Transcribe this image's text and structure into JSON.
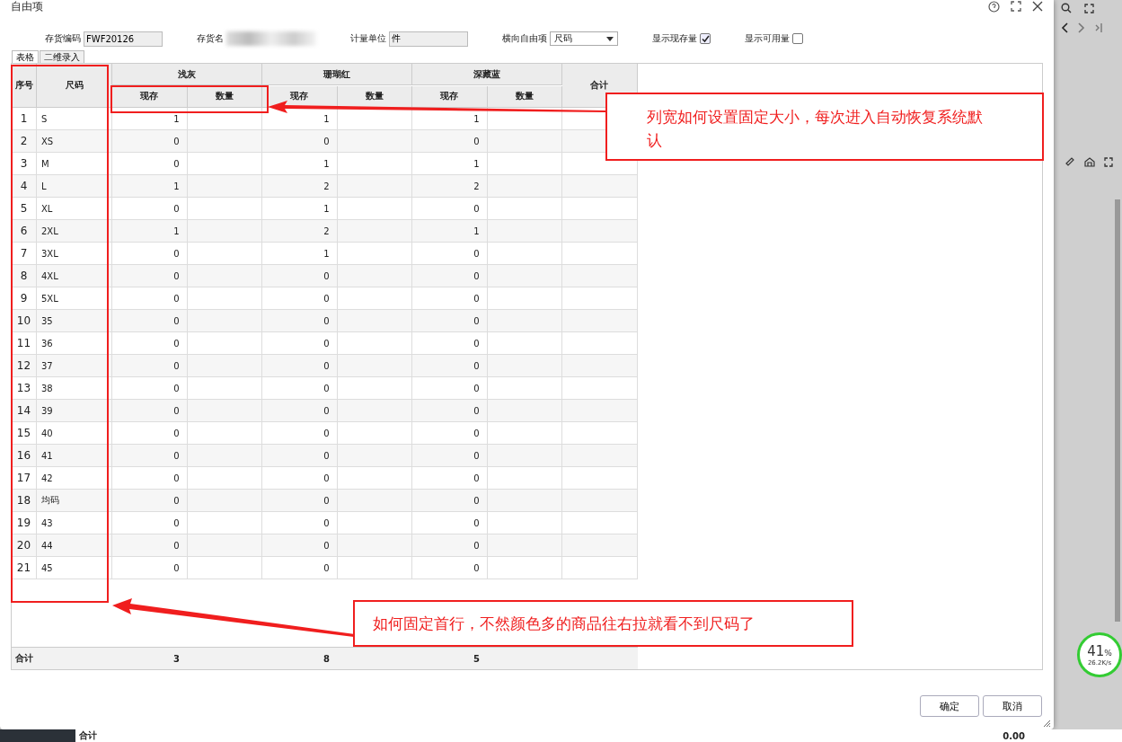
{
  "dialog": {
    "title": "自由项"
  },
  "form": [
    {
      "kind": "input",
      "label": "存货编码",
      "value": "FWF20126"
    },
    {
      "kind": "blurred",
      "label": "存货名"
    },
    {
      "kind": "input",
      "label": "计量单位",
      "value": "件"
    },
    {
      "kind": "select",
      "label": "横向自由项",
      "value": "尺码"
    },
    {
      "kind": "checkbox",
      "label": "显示现存量",
      "checked": true
    },
    {
      "kind": "checkbox",
      "label": "显示可用量",
      "checked": false
    }
  ],
  "tabs": [
    {
      "label": "表格",
      "selected": true
    },
    {
      "label": "二维录入",
      "selected": false
    }
  ],
  "table": {
    "seq_header": "序号",
    "size_header": "尺码",
    "total_header": "合计",
    "colors": [
      {
        "name": "浅灰",
        "sub_headers": [
          "现存",
          "数量"
        ]
      },
      {
        "name": "珊瑚红",
        "sub_headers": [
          "现存",
          "数量"
        ]
      },
      {
        "name": "深藏蓝",
        "sub_headers": [
          "现存",
          "数量"
        ]
      }
    ],
    "rows": [
      {
        "seq": "1",
        "size": "S",
        "stock": [
          "1",
          "1",
          "1"
        ]
      },
      {
        "seq": "2",
        "size": "XS",
        "stock": [
          "0",
          "0",
          "0"
        ]
      },
      {
        "seq": "3",
        "size": "M",
        "stock": [
          "0",
          "1",
          "1"
        ]
      },
      {
        "seq": "4",
        "size": "L",
        "stock": [
          "1",
          "2",
          "2"
        ]
      },
      {
        "seq": "5",
        "size": "XL",
        "stock": [
          "0",
          "1",
          "0"
        ]
      },
      {
        "seq": "6",
        "size": "2XL",
        "stock": [
          "1",
          "2",
          "1"
        ]
      },
      {
        "seq": "7",
        "size": "3XL",
        "stock": [
          "0",
          "1",
          "0"
        ]
      },
      {
        "seq": "8",
        "size": "4XL",
        "stock": [
          "0",
          "0",
          "0"
        ]
      },
      {
        "seq": "9",
        "size": "5XL",
        "stock": [
          "0",
          "0",
          "0"
        ]
      },
      {
        "seq": "10",
        "size": "35",
        "stock": [
          "0",
          "0",
          "0"
        ]
      },
      {
        "seq": "11",
        "size": "36",
        "stock": [
          "0",
          "0",
          "0"
        ]
      },
      {
        "seq": "12",
        "size": "37",
        "stock": [
          "0",
          "0",
          "0"
        ]
      },
      {
        "seq": "13",
        "size": "38",
        "stock": [
          "0",
          "0",
          "0"
        ]
      },
      {
        "seq": "14",
        "size": "39",
        "stock": [
          "0",
          "0",
          "0"
        ]
      },
      {
        "seq": "15",
        "size": "40",
        "stock": [
          "0",
          "0",
          "0"
        ]
      },
      {
        "seq": "16",
        "size": "41",
        "stock": [
          "0",
          "0",
          "0"
        ]
      },
      {
        "seq": "17",
        "size": "42",
        "stock": [
          "0",
          "0",
          "0"
        ]
      },
      {
        "seq": "18",
        "size": "均码",
        "stock": [
          "0",
          "0",
          "0"
        ]
      },
      {
        "seq": "19",
        "size": "43",
        "stock": [
          "0",
          "0",
          "0"
        ]
      },
      {
        "seq": "20",
        "size": "44",
        "stock": [
          "0",
          "0",
          "0"
        ]
      },
      {
        "seq": "21",
        "size": "45",
        "stock": [
          "0",
          "0",
          "0"
        ]
      }
    ],
    "footer": {
      "label": "合计",
      "stock": [
        "3",
        "8",
        "5"
      ]
    }
  },
  "buttons": [
    "确定",
    "取消"
  ],
  "annotations": [
    {
      "text": "列宽如何设置固定大小，每次进入自动恢复系统默认"
    },
    {
      "text": "如何固定首行，不然颜色多的商品往右拉就看不到尺码了"
    }
  ],
  "background": {
    "footer_label": "合计",
    "footer_value": "0.00",
    "network_widget": {
      "percent": "41",
      "unit": "%",
      "speed": "26.2K/s"
    }
  }
}
